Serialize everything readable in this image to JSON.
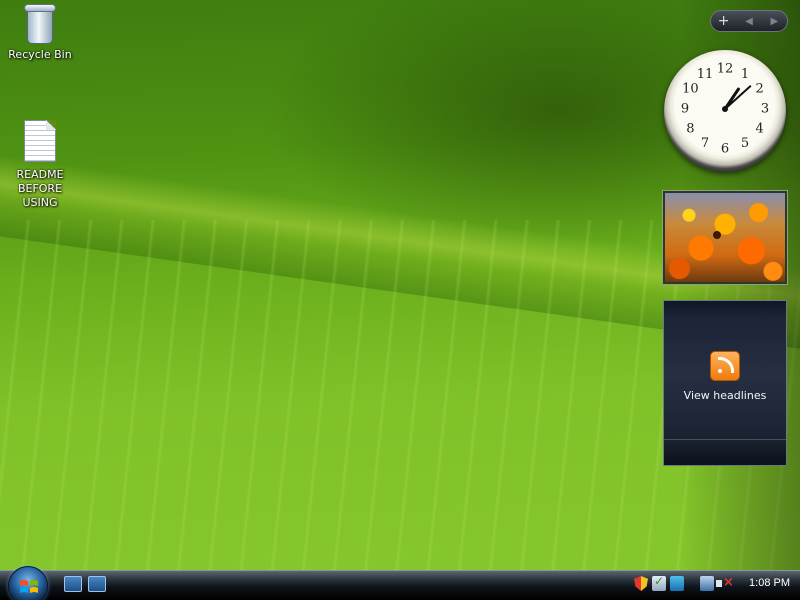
{
  "desktop": {
    "icons": [
      {
        "label": "Recycle Bin",
        "icon": "recycle-bin-icon"
      },
      {
        "label": "README\nBEFORE\nUSING",
        "icon": "text-document-icon"
      }
    ]
  },
  "sidebar": {
    "controls": {
      "add": "+",
      "prev": "◀",
      "next": "▶"
    },
    "feed_gadget": {
      "label": "View headlines",
      "icon": "rss-feed-icon"
    }
  },
  "clock_gadget": {
    "time": "1:08",
    "numbers": [
      "12",
      "1",
      "2",
      "3",
      "4",
      "5",
      "6",
      "7",
      "8",
      "9",
      "10",
      "11"
    ]
  },
  "taskbar": {
    "time": "1:08 PM",
    "start_icon": "windows-start-orb",
    "quick_launch": [
      "show-desktop-icon",
      "switch-windows-icon"
    ],
    "tray_icons": [
      "security-shield-icon",
      "windows-defender-icon",
      "windows-update-icon",
      "network-icon",
      "volume-muted-icon"
    ]
  },
  "colors": {
    "wallpaper_green": "#6aae1c",
    "taskbar_black": "#0f141a",
    "rss_orange": "#f07a0c"
  }
}
